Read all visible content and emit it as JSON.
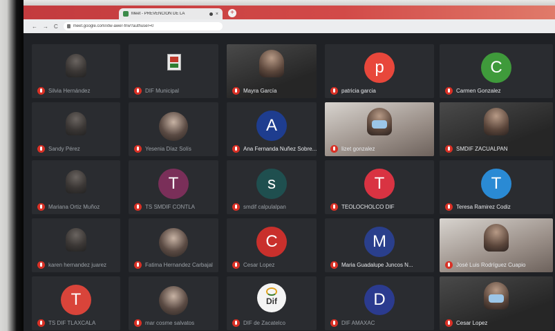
{
  "browser": {
    "tab_title": "Meet - PREVENCIÓN DE LA",
    "tab_close": "×",
    "new_tab": "+",
    "url": "meet.google.com/xtw-awer-fnw?authuser=0",
    "nav_back": "←",
    "nav_forward": "→",
    "nav_reload": "C"
  },
  "participants": [
    {
      "name": "Silvia Hernández",
      "type": "photo",
      "dim": true
    },
    {
      "name": "DIF Municipal",
      "type": "logo",
      "dim": true
    },
    {
      "name": "Mayra García",
      "type": "camera",
      "dim": false
    },
    {
      "name": "patricia garcia",
      "type": "initial",
      "initial": "p",
      "color": "#e8473b",
      "dim": false
    },
    {
      "name": "Carmen Gonzalez",
      "type": "initial",
      "initial": "C",
      "color": "#3f9a3b",
      "dim": false
    },
    {
      "name": "Sandy Pérez",
      "type": "photo",
      "dim": true
    },
    {
      "name": "Yesenia Díaz Solís",
      "type": "photo",
      "dim": true
    },
    {
      "name": "Ana Fernanda Nuñez Sobre...",
      "type": "initial",
      "initial": "A",
      "color": "#1e3d8f",
      "dim": false
    },
    {
      "name": "lizet gonzalez",
      "type": "camera",
      "dim": false
    },
    {
      "name": "SMDIF ZACUALPAN",
      "type": "camera",
      "dim": false
    },
    {
      "name": "Mariana Ortiz Muñoz",
      "type": "photo",
      "dim": true
    },
    {
      "name": "TS SMDIF CONTLA",
      "type": "initial",
      "initial": "T",
      "color": "#7a2f59",
      "dim": true
    },
    {
      "name": "smdif calpulalpan",
      "type": "initial",
      "initial": "s",
      "color": "#1f4f4f",
      "dim": true
    },
    {
      "name": "TEOLOCHOLCO DIF",
      "type": "initial",
      "initial": "T",
      "color": "#d93342",
      "dim": false
    },
    {
      "name": "Teresa Ramirez Codiz",
      "type": "initial",
      "initial": "T",
      "color": "#2a8ad4",
      "dim": false
    },
    {
      "name": "karen hernandez juarez",
      "type": "photo",
      "dim": true
    },
    {
      "name": "Fatima Hernandez Carbajal",
      "type": "photo",
      "dim": true
    },
    {
      "name": "Cesar Lopez",
      "type": "initial",
      "initial": "C",
      "color": "#c9302c",
      "dim": true
    },
    {
      "name": "Maria Guadalupe Juncos N...",
      "type": "initial",
      "initial": "M",
      "color": "#2a3f8c",
      "dim": false
    },
    {
      "name": "José Luis Rodríguez Cuapio",
      "type": "camera",
      "dim": false
    },
    {
      "name": "TS DIF TLAXCALA",
      "type": "initial",
      "initial": "T",
      "color": "#d9443a",
      "dim": true
    },
    {
      "name": "mar cosme salvatos",
      "type": "photo",
      "dim": true
    },
    {
      "name": "DIF de Zacatelco",
      "type": "logo-dif",
      "logo_text": "Dif",
      "dim": true
    },
    {
      "name": "DIF AMAXAC",
      "type": "initial",
      "initial": "D",
      "color": "#2b3b8f",
      "dim": true
    },
    {
      "name": "Cesar Lopez",
      "type": "camera",
      "dim": false
    }
  ]
}
